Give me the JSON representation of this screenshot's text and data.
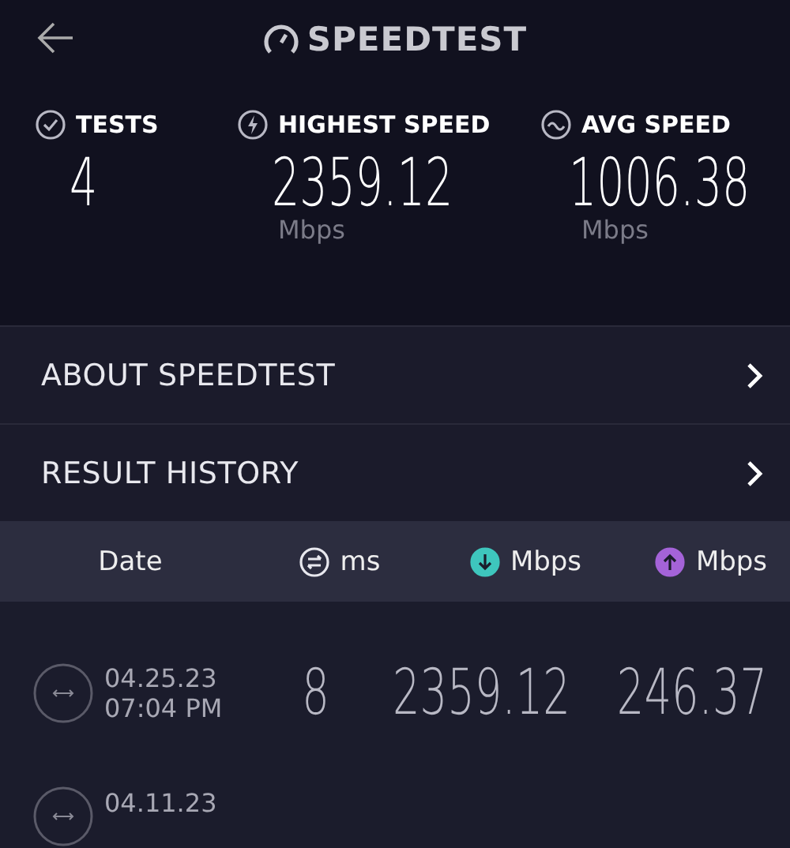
{
  "header": {
    "title": "SPEEDTEST"
  },
  "stats": [
    {
      "kind": "tests",
      "label": "TESTS",
      "value": "4"
    },
    {
      "kind": "highest",
      "label": "HIGHEST SPEED",
      "value": "2359.12",
      "unit": "Mbps"
    },
    {
      "kind": "avg",
      "label": "AVG SPEED",
      "value": "1006.38",
      "unit": "Mbps"
    }
  ],
  "menu": [
    {
      "label": "ABOUT SPEEDTEST"
    },
    {
      "label": "RESULT HISTORY"
    }
  ],
  "table": {
    "columns": [
      {
        "kind": "date",
        "label": "Date"
      },
      {
        "kind": "ping",
        "label": "ms"
      },
      {
        "kind": "download",
        "label": "Mbps"
      },
      {
        "kind": "upload",
        "label": "Mbps"
      }
    ],
    "rows": [
      {
        "date": "04.25.23",
        "time": "07:04 PM",
        "ping": "8",
        "download": "2359.12",
        "upload": "246.37"
      },
      {
        "date": "04.11.23"
      }
    ]
  }
}
